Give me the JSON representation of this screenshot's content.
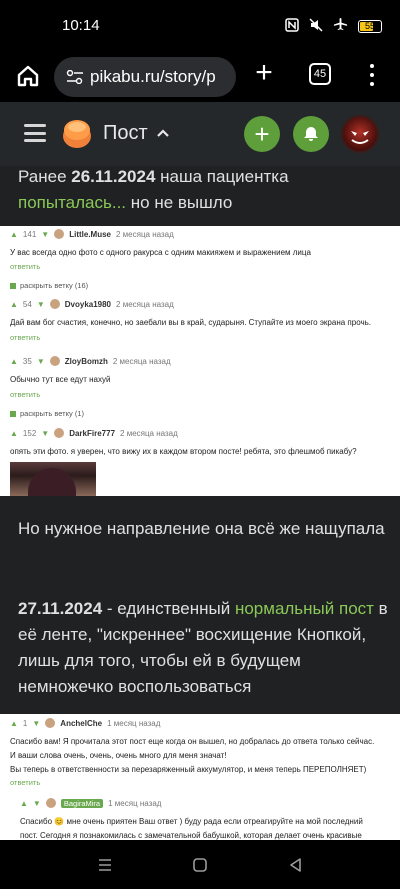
{
  "status": {
    "time": "10:14",
    "battery": "55"
  },
  "browser": {
    "url": "pikabu.ru/story/p",
    "tabs_count": "45"
  },
  "header": {
    "title": "Пост"
  },
  "post": {
    "p1_pre": "Ранее ",
    "p1_date": "26.11.2024",
    "p1_mid": " наша пациентка ",
    "p1_link": "попыталась...",
    "p1_post": " но не вышло",
    "p2": "Но нужное направление она всё же нащупала",
    "p3_date": "27.11.2024",
    "p3_mid": " - единственный ",
    "p3_link": "нормальный пост",
    "p3_post": " в её ленте, \"искреннее\" восхищение Кнопкой, лишь для того, чтобы ей в будущем немножечко воспользоваться"
  },
  "shot1": {
    "comments": [
      {
        "votes": "141",
        "user": "Little.Muse",
        "time": "2 месяца назад",
        "text": "У вас всегда одно фото с одного ракурса с одним макияжем и выражением лица",
        "reply": "ответить"
      },
      {
        "votes": "54",
        "user": "Dvoyka1980",
        "time": "2 месяца назад",
        "text": "Дай вам бог счастия, конечно, но заебали вы в край, сударыня. Ступайте из моего экрана прочь.",
        "reply": "ответить"
      },
      {
        "votes": "35",
        "user": "ZloyBomzh",
        "time": "2 месяца назад",
        "text": "Обычно тут все едут нахуй",
        "reply": "ответить"
      },
      {
        "votes": "152",
        "user": "DarkFire777",
        "time": "2 месяца назад",
        "text": "опять эти фото. я уверен, что вижу их в каждом втором посте! ребята, это флешмоб пикабу?",
        "reply": ""
      }
    ],
    "branch1": "раскрыть ветку (16)",
    "branch2": "раскрыть ветку (1)"
  },
  "shot2": {
    "c1": {
      "votes": "1",
      "user": "AnchelChe",
      "time": "1 месяц назад"
    },
    "c1_lines": [
      "Спасибо вам! Я прочитала этот пост еще когда он вышел, но добралась до ответа только сейчас.",
      "И ваши слова очень, очень, очень много для меня значат!",
      "Вы теперь в ответственности за перезаряженный аккумулятор, и меня теперь ПЕРЕПОЛНЯЕТ)"
    ],
    "c1_reply": "ответить",
    "c2": {
      "user": "BagiraMira",
      "time": "1 месяц назад"
    },
    "c2_lines": [
      "Спасибо 😊 мне очень приятен Ваш ответ ) буду рада если отреагируйте на мой последний",
      "пост. Сегодня я познакомилась с замечательной бабушкой, которая делает очень красивые"
    ]
  },
  "colors": {
    "accent": "#5e9f3b",
    "link": "#8ac858"
  }
}
